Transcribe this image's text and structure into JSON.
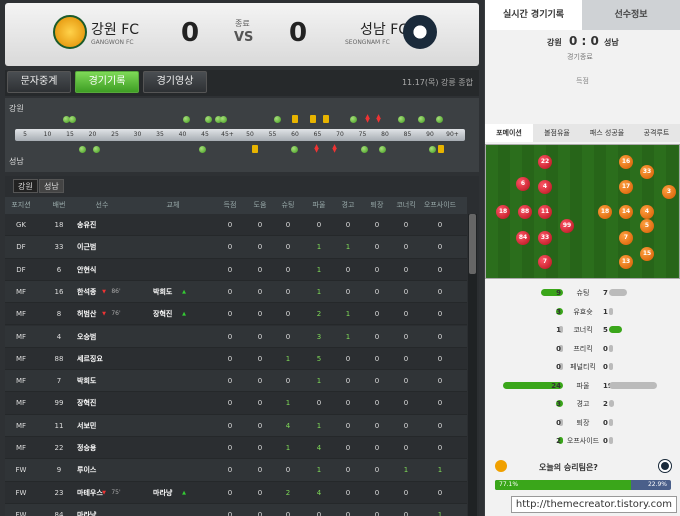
{
  "match": {
    "home_name": "강원 FC",
    "home_en": "GANGWON FC",
    "away_name": "성남 FC",
    "away_en": "SEONGNAM FC",
    "home_score": "0",
    "away_score": "0",
    "status": "종료",
    "vs": "VS",
    "date_venue": "11.17(목) 강릉 종합",
    "home_color": "#f0a000",
    "away_color": "#1a2a3a"
  },
  "tabs": [
    "문자중계",
    "경기기록",
    "경기영상"
  ],
  "active_tab": "경기기록",
  "timeline": {
    "home_label": "강원",
    "away_label": "성남",
    "ticks": [
      "5",
      "10",
      "15",
      "20",
      "25",
      "30",
      "35",
      "40",
      "45",
      "45+",
      "50",
      "55",
      "60",
      "65",
      "70",
      "75",
      "80",
      "85",
      "90",
      "90+"
    ]
  },
  "table": {
    "subtabs": [
      "강원",
      "성남"
    ],
    "headers": [
      "포지션",
      "배번",
      "선수",
      "교체",
      "득점",
      "도움",
      "슈팅",
      "파울",
      "경고",
      "퇴장",
      "코너킥",
      "오프사이드"
    ],
    "rows": [
      {
        "pos": "GK",
        "no": "18",
        "name": "송유진",
        "sub": "",
        "g": "0",
        "a": "0",
        "sh": "0",
        "f": "0",
        "yc": "0",
        "rc": "0",
        "ck": "0",
        "off": "0"
      },
      {
        "pos": "DF",
        "no": "33",
        "name": "이근범",
        "sub": "",
        "g": "0",
        "a": "0",
        "sh": "0",
        "f": "1",
        "yc": "1",
        "rc": "0",
        "ck": "0",
        "off": "0"
      },
      {
        "pos": "DF",
        "no": "6",
        "name": "안현식",
        "sub": "",
        "g": "0",
        "a": "0",
        "sh": "0",
        "f": "1",
        "yc": "0",
        "rc": "0",
        "ck": "0",
        "off": "0"
      },
      {
        "pos": "MF",
        "no": "16",
        "name": "한석종",
        "min": "86'",
        "sub": "박희도",
        "g": "0",
        "a": "0",
        "sh": "0",
        "f": "1",
        "yc": "0",
        "rc": "0",
        "ck": "0",
        "off": "0"
      },
      {
        "pos": "MF",
        "no": "8",
        "name": "허범산",
        "min": "76'",
        "sub": "장혁진",
        "g": "0",
        "a": "0",
        "sh": "0",
        "f": "2",
        "yc": "1",
        "rc": "0",
        "ck": "0",
        "off": "0"
      },
      {
        "pos": "MF",
        "no": "4",
        "name": "오승범",
        "sub": "",
        "g": "0",
        "a": "0",
        "sh": "0",
        "f": "3",
        "yc": "1",
        "rc": "0",
        "ck": "0",
        "off": "0"
      },
      {
        "pos": "MF",
        "no": "88",
        "name": "세르징요",
        "sub": "",
        "g": "0",
        "a": "0",
        "sh": "1",
        "f": "5",
        "yc": "0",
        "rc": "0",
        "ck": "0",
        "off": "0"
      },
      {
        "pos": "MF",
        "no": "7",
        "name": "박희도",
        "sub": "",
        "g": "0",
        "a": "0",
        "sh": "0",
        "f": "1",
        "yc": "0",
        "rc": "0",
        "ck": "0",
        "off": "0"
      },
      {
        "pos": "MF",
        "no": "99",
        "name": "장혁진",
        "sub": "",
        "g": "0",
        "a": "0",
        "sh": "1",
        "f": "0",
        "yc": "0",
        "rc": "0",
        "ck": "0",
        "off": "0"
      },
      {
        "pos": "MF",
        "no": "11",
        "name": "서보민",
        "sub": "",
        "g": "0",
        "a": "0",
        "sh": "4",
        "f": "1",
        "yc": "0",
        "rc": "0",
        "ck": "0",
        "off": "0"
      },
      {
        "pos": "MF",
        "no": "22",
        "name": "정승용",
        "sub": "",
        "g": "0",
        "a": "0",
        "sh": "1",
        "f": "4",
        "yc": "0",
        "rc": "0",
        "ck": "0",
        "off": "0"
      },
      {
        "pos": "FW",
        "no": "9",
        "name": "루이스",
        "sub": "",
        "g": "0",
        "a": "0",
        "sh": "0",
        "f": "1",
        "yc": "0",
        "rc": "0",
        "ck": "1",
        "off": "1"
      },
      {
        "pos": "FW",
        "no": "23",
        "name": "마테우스",
        "min": "75'",
        "sub": "마라냥",
        "g": "0",
        "a": "0",
        "sh": "2",
        "f": "4",
        "yc": "0",
        "rc": "0",
        "ck": "0",
        "off": "0"
      },
      {
        "pos": "FW",
        "no": "84",
        "name": "마라냥",
        "sub": "",
        "g": "0",
        "a": "0",
        "sh": "0",
        "f": "0",
        "yc": "0",
        "rc": "0",
        "ck": "0",
        "off": "1"
      }
    ]
  },
  "right": {
    "tab_live": "실시간 경기기록",
    "tab_info": "선수정보",
    "home": "강원",
    "away": "성남",
    "score": "0 : 0",
    "status": "경기종료",
    "scorer_label": "득점",
    "subtabs": [
      "포메이션",
      "볼점유율",
      "패스 성공율",
      "공격루트"
    ],
    "home_players": [
      "22",
      "6",
      "4",
      "18",
      "88",
      "11",
      "99",
      "84",
      "33",
      "7"
    ],
    "away_players": [
      "16",
      "33",
      "17",
      "18",
      "14",
      "4",
      "3",
      "7",
      "5",
      "15",
      "13"
    ],
    "stats": [
      {
        "label": "슈팅",
        "h": "9",
        "a": "7",
        "hv": 9,
        "av": 7
      },
      {
        "label": "유효슛",
        "h": "3",
        "a": "1",
        "hv": 3,
        "av": 1
      },
      {
        "label": "코너킥",
        "h": "1",
        "a": "5",
        "hv": 1,
        "av": 5
      },
      {
        "label": "프리킥",
        "h": "0",
        "a": "0",
        "hv": 0,
        "av": 0
      },
      {
        "label": "페널티킥",
        "h": "0",
        "a": "0",
        "hv": 0,
        "av": 0
      },
      {
        "label": "파울",
        "h": "24",
        "a": "19",
        "hv": 24,
        "av": 19
      },
      {
        "label": "경고",
        "h": "3",
        "a": "2",
        "hv": 3,
        "av": 2
      },
      {
        "label": "퇴장",
        "h": "0",
        "a": "0",
        "hv": 0,
        "av": 0
      },
      {
        "label": "오프사이드",
        "h": "2",
        "a": "0",
        "hv": 2,
        "av": 0
      }
    ],
    "vote_title": "오늘의 승리팀은?",
    "vote_home": "77.1%",
    "vote_away": "22.9%",
    "vote_home_frac": 0.771
  },
  "watermark": "http://themecreator.tistory.com"
}
